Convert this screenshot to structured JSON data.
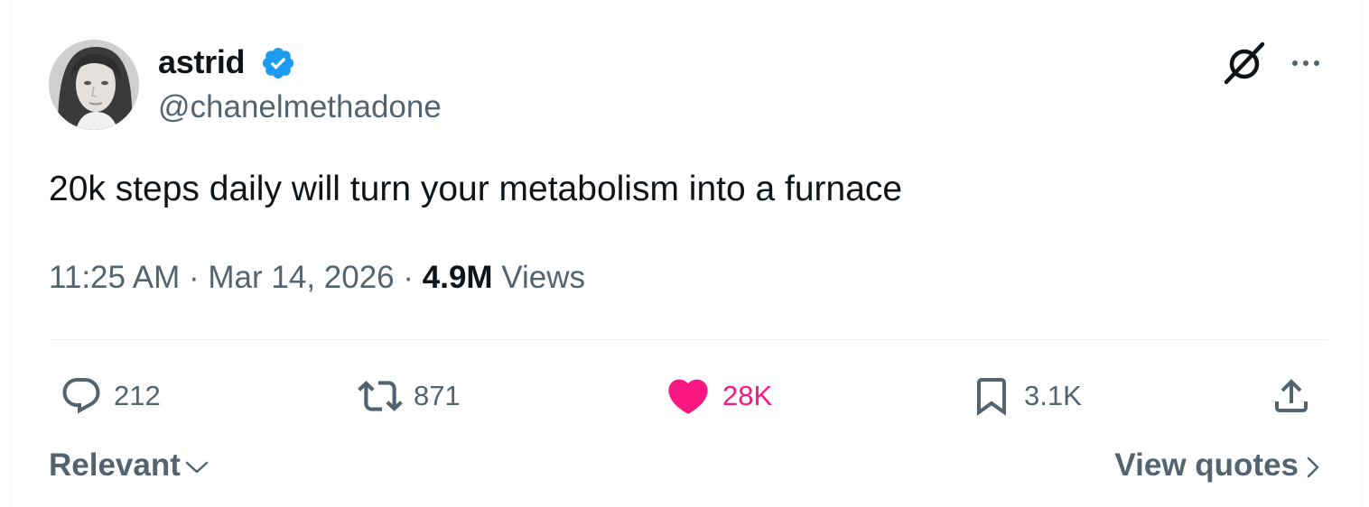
{
  "post": {
    "author": {
      "display_name": "astrid",
      "handle": "@chanelmethadone",
      "verified": true
    },
    "text": "20k steps daily will turn your metabolism into a furnace",
    "meta": {
      "time": "11:25 AM",
      "separator1": " · ",
      "date": "Mar 14, 2026",
      "separator2": " · ",
      "views_count": "4.9M",
      "views_label": " Views"
    },
    "actions": {
      "replies": "212",
      "reposts": "871",
      "likes": "28K",
      "bookmarks": "3.1K"
    },
    "footer": {
      "sort_label": "Relevant",
      "view_quotes_label": "View quotes"
    }
  },
  "colors": {
    "text_primary": "#0f1419",
    "text_secondary": "#536471",
    "like_active": "#f91880",
    "verified_blue": "#1d9bf0",
    "divider": "#eff3f4"
  },
  "icons": {
    "verified": "verified-badge-icon",
    "grok": "grok-icon",
    "more": "more-icon",
    "reply": "reply-icon",
    "retweet": "retweet-icon",
    "like": "heart-icon",
    "bookmark": "bookmark-icon",
    "share": "share-icon",
    "chevron_down": "chevron-down-icon",
    "chevron_right": "chevron-right-icon"
  }
}
